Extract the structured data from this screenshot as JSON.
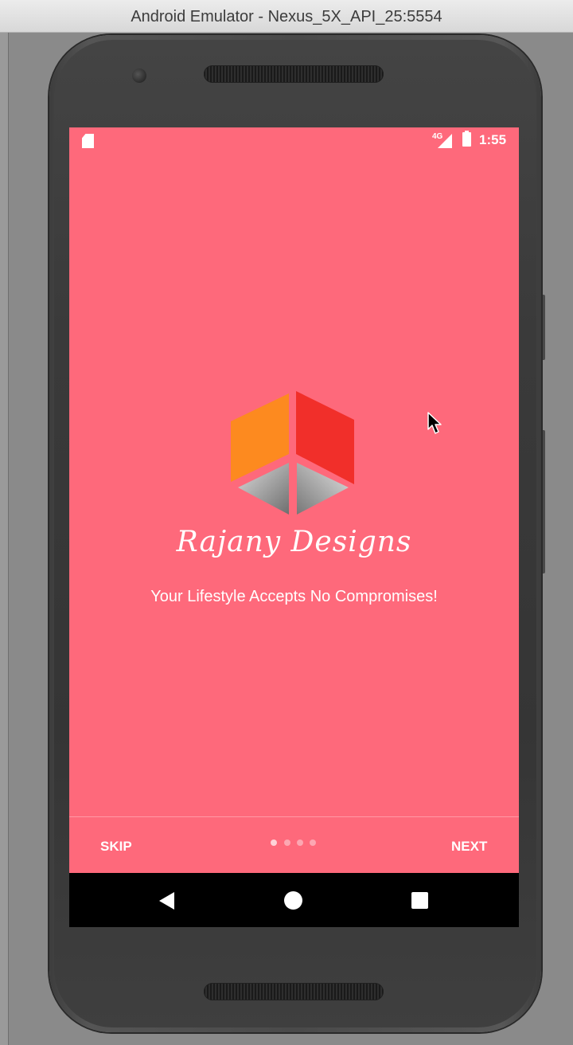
{
  "window": {
    "title": "Android Emulator - Nexus_5X_API_25:5554"
  },
  "status_bar": {
    "network": "4G",
    "time": "1:55",
    "icons": [
      "sd-card-icon",
      "signal-icon",
      "battery-charging-icon"
    ]
  },
  "onboarding": {
    "brand_name": "Rajany Designs",
    "tagline": "Your Lifestyle Accepts No Compromises!",
    "skip_label": "SKIP",
    "next_label": "NEXT",
    "pager": {
      "total_pages": 4,
      "current_page": 1
    }
  },
  "navigation_bar": {
    "icons": [
      "back-icon",
      "home-icon",
      "recents-icon"
    ]
  },
  "colors": {
    "screen_background": "#fe697b",
    "logo_orange": "#fd8a1f",
    "logo_red": "#f12f2a",
    "text": "#ffffff"
  }
}
